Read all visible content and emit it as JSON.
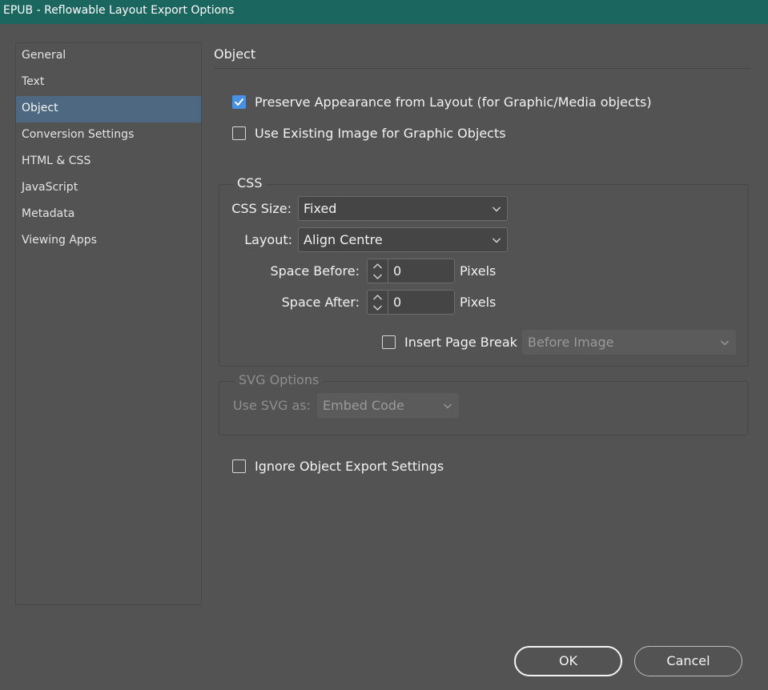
{
  "window": {
    "title": "EPUB - Reflowable Layout Export Options"
  },
  "sidebar": {
    "items": [
      {
        "label": "General"
      },
      {
        "label": "Text"
      },
      {
        "label": "Object",
        "selected": true
      },
      {
        "label": "Conversion Settings"
      },
      {
        "label": "HTML & CSS"
      },
      {
        "label": "JavaScript"
      },
      {
        "label": "Metadata"
      },
      {
        "label": "Viewing Apps"
      }
    ]
  },
  "main": {
    "title": "Object",
    "preserve_appearance": {
      "label": "Preserve Appearance from Layout (for Graphic/Media objects)",
      "checked": true
    },
    "use_existing_image": {
      "label": "Use Existing Image for Graphic Objects",
      "checked": false
    },
    "css": {
      "legend": "CSS",
      "css_size": {
        "label": "CSS Size:",
        "value": "Fixed"
      },
      "layout": {
        "label": "Layout:",
        "value": "Align Centre"
      },
      "space_before": {
        "label": "Space Before:",
        "value": "0",
        "unit": "Pixels"
      },
      "space_after": {
        "label": "Space After:",
        "value": "0",
        "unit": "Pixels"
      },
      "insert_page_break": {
        "label": "Insert Page Break",
        "checked": false,
        "value": "Before Image"
      }
    },
    "svg": {
      "legend": "SVG Options",
      "use_svg_as": {
        "label": "Use SVG as:",
        "value": "Embed Code"
      }
    },
    "ignore_object_export": {
      "label": "Ignore Object Export Settings",
      "checked": false
    }
  },
  "buttons": {
    "ok": "OK",
    "cancel": "Cancel"
  },
  "colors": {
    "titlebar": "#1c6660",
    "accent": "#4a90e2",
    "selection": "#4e6882",
    "background": "#535353"
  }
}
